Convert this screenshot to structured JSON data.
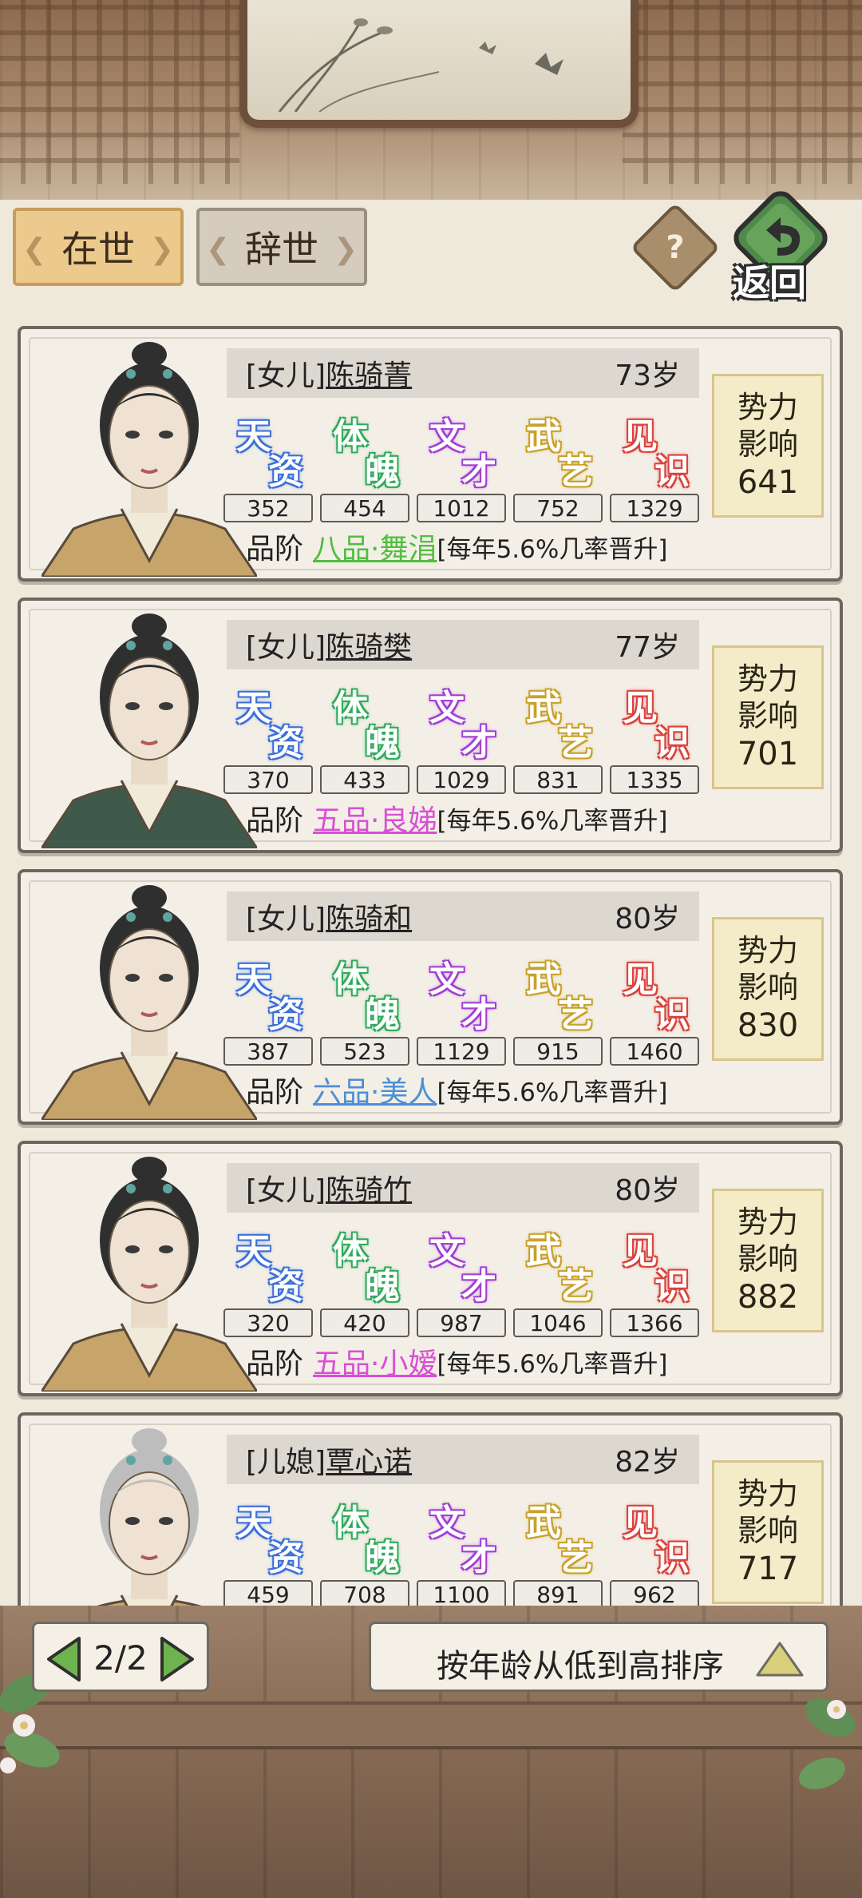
{
  "tabs": {
    "active_label": "在世",
    "inactive_label": "辞世"
  },
  "header": {
    "help_label": "?",
    "back_label": "返回"
  },
  "attr_labels": [
    {
      "c1": "天",
      "c2": "资",
      "color": "#3d6fd8"
    },
    {
      "c1": "体",
      "c2": "魄",
      "color": "#2faa5a"
    },
    {
      "c1": "文",
      "c2": "才",
      "color": "#a23fd6"
    },
    {
      "c1": "武",
      "c2": "艺",
      "color": "#c9a12c"
    },
    {
      "c1": "见",
      "c2": "识",
      "color": "#d9423c"
    }
  ],
  "power_label_1": "势力",
  "power_label_2": "影响",
  "rank_label": "品阶",
  "members": [
    {
      "relation": "[女儿]",
      "name": "陈骑菁",
      "age": "73岁",
      "stats": [
        "352",
        "454",
        "1012",
        "752",
        "1329"
      ],
      "rank": "八品·舞涓",
      "rank_color": "#4fbf3f",
      "note": "[每年5.6%几率晋升]",
      "power": "641",
      "robe": "#c7a46a",
      "hair": "#2f2f2f"
    },
    {
      "relation": "[女儿]",
      "name": "陈骑樊",
      "age": "77岁",
      "stats": [
        "370",
        "433",
        "1029",
        "831",
        "1335"
      ],
      "rank": "五品·良娣",
      "rank_color": "#d84fd6",
      "note": "[每年5.6%几率晋升]",
      "power": "701",
      "robe": "#3f5a4c",
      "hair": "#2f2f2f"
    },
    {
      "relation": "[女儿]",
      "name": "陈骑和",
      "age": "80岁",
      "stats": [
        "387",
        "523",
        "1129",
        "915",
        "1460"
      ],
      "rank": "六品·美人",
      "rank_color": "#4b8fd6",
      "note": "[每年5.6%几率晋升]",
      "power": "830",
      "robe": "#c7a46a",
      "hair": "#2f2f2f"
    },
    {
      "relation": "[女儿]",
      "name": "陈骑竹",
      "age": "80岁",
      "stats": [
        "320",
        "420",
        "987",
        "1046",
        "1366"
      ],
      "rank": "五品·小嫒",
      "rank_color": "#d84fd6",
      "note": "[每年5.6%几率晋升]",
      "power": "882",
      "robe": "#c7a46a",
      "hair": "#2f2f2f"
    },
    {
      "relation": "[儿媳]",
      "name": "覃心诺",
      "age": "82岁",
      "stats": [
        "459",
        "708",
        "1100",
        "891",
        "962"
      ],
      "rank": "",
      "rank_color": "#222",
      "note": "",
      "power": "717",
      "robe": "#c7a46a",
      "hair": "#bdbdbd"
    }
  ],
  "pager": {
    "page_text": "2/2"
  },
  "sort": {
    "label": "按年龄从低到高排序"
  }
}
